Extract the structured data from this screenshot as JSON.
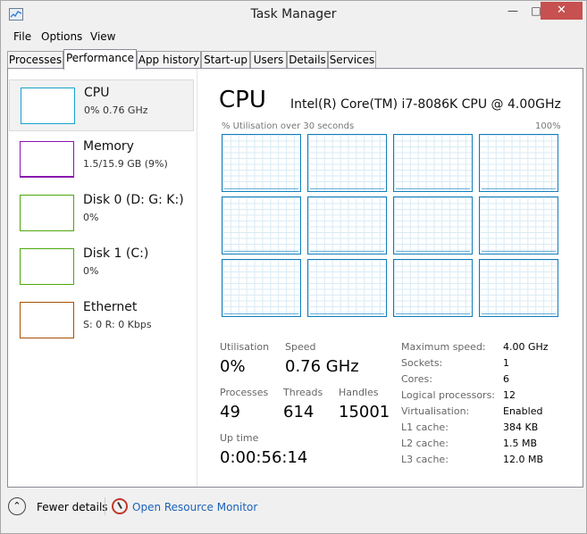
{
  "window": {
    "title": "Task Manager"
  },
  "menu": [
    "File",
    "Options",
    "View"
  ],
  "tabs": [
    "Processes",
    "Performance",
    "App history",
    "Start-up",
    "Users",
    "Details",
    "Services"
  ],
  "resources": [
    {
      "title": "CPU",
      "sub": "0% 0.76 GHz",
      "color": "#17a2cf"
    },
    {
      "title": "Memory",
      "sub": "1.5/15.9 GB (9%)",
      "color": "#8b12ae"
    },
    {
      "title": "Disk 0 (D: G: K:)",
      "sub": "0%",
      "color": "#4da60c"
    },
    {
      "title": "Disk 1 (C:)",
      "sub": "0%",
      "color": "#4da60c"
    },
    {
      "title": "Ethernet",
      "sub": "S: 0 R: 0 Kbps",
      "color": "#a74f01"
    }
  ],
  "detail": {
    "title": "CPU",
    "name": "Intel(R) Core(TM) i7-8086K CPU @ 4.00GHz",
    "graph_left": "% Utilisation over 30 seconds",
    "graph_right": "100%",
    "stats": {
      "utilisation_label": "Utilisation",
      "utilisation": "0%",
      "speed_label": "Speed",
      "speed": "0.76 GHz",
      "processes_label": "Processes",
      "processes": "49",
      "threads_label": "Threads",
      "threads": "614",
      "handles_label": "Handles",
      "handles": "15001",
      "uptime_label": "Up time",
      "uptime": "0:00:56:14"
    },
    "info": [
      {
        "key": "Maximum speed:",
        "value": "4.00 GHz"
      },
      {
        "key": "Sockets:",
        "value": "1"
      },
      {
        "key": "Cores:",
        "value": "6"
      },
      {
        "key": "Logical processors:",
        "value": "12"
      },
      {
        "key": "Virtualisation:",
        "value": "Enabled"
      },
      {
        "key": "L1 cache:",
        "value": "384 KB"
      },
      {
        "key": "L2 cache:",
        "value": "1.5 MB"
      },
      {
        "key": "L3 cache:",
        "value": "12.0 MB"
      }
    ]
  },
  "footer": {
    "fewer_details": "Fewer details",
    "open_resource_monitor": "Open Resource Monitor"
  },
  "icons": {
    "app": "task-manager-icon",
    "fewer": "chevron-up-icon",
    "resource_monitor": "resource-monitor-icon"
  }
}
